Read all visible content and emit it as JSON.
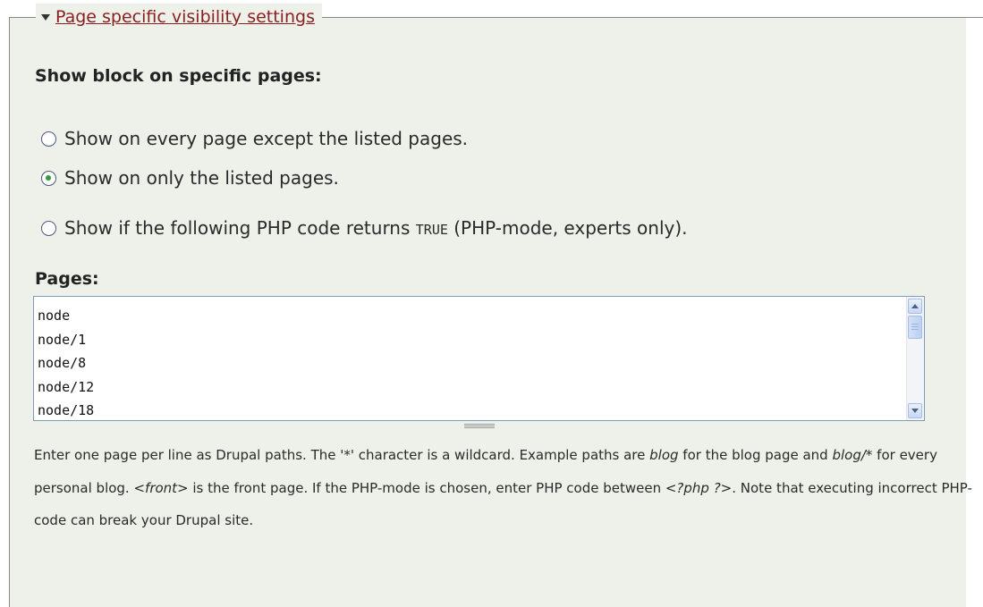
{
  "fieldset": {
    "legend": "Page specific visibility settings"
  },
  "visibility": {
    "heading": "Show block on specific pages:",
    "options": [
      {
        "label": "Show on every page except the listed pages.",
        "checked": false
      },
      {
        "label": "Show on only the listed pages.",
        "checked": true
      },
      {
        "label_prefix": "Show if the following PHP code returns ",
        "label_code": "TRUE",
        "label_suffix": " (PHP-mode, experts only).",
        "checked": false
      }
    ]
  },
  "pages": {
    "label": "Pages:",
    "lines": [
      "node",
      "node/1",
      "node/8",
      "node/12",
      "node/18"
    ]
  },
  "help": {
    "p1": "Enter one page per line as Drupal paths. The '*' character is a wildcard. Example paths are ",
    "e1": "blog",
    "p2": " for the blog page and ",
    "e2": "blog/*",
    "p3": " for every personal blog. ",
    "e3": "<front>",
    "p4": " is the front page. If the PHP-mode is chosen, enter PHP code between ",
    "e4": "<?php ?>",
    "p5": ". Note that executing incorrect PHP-code can break your Drupal site."
  },
  "colors": {
    "panel_background": "#eef0ea",
    "legend_link": "#8b1f1f",
    "radio_selected": "#2f9e3a",
    "textarea_border": "#7f9db9"
  },
  "icons": {
    "legend_toggle": "triangle-down-icon",
    "scroll_up": "scroll-up-arrow-icon",
    "scroll_down": "scroll-down-arrow-icon",
    "resize": "grippie-icon"
  }
}
